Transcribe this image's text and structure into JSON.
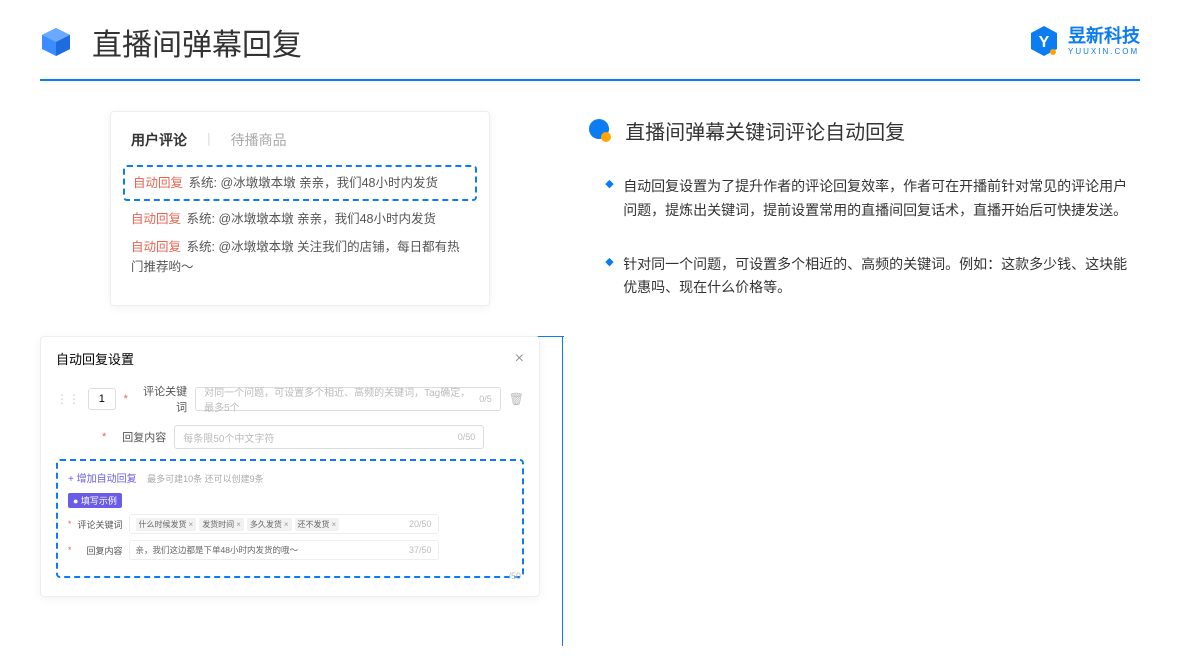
{
  "header": {
    "title": "直播间弹幕回复",
    "brand_name": "昱新科技",
    "brand_sub": "YUUXIN.COM"
  },
  "comments_panel": {
    "tab_active": "用户评论",
    "tab_inactive": "待播商品",
    "items": [
      {
        "tag": "自动回复",
        "body": "系统: @冰墩墩本墩 亲亲，我们48小时内发货"
      },
      {
        "tag": "自动回复",
        "body": "系统: @冰墩墩本墩 亲亲，我们48小时内发货"
      },
      {
        "tag": "自动回复",
        "body": "系统: @冰墩墩本墩 关注我们的店铺，每日都有热门推荐哟～"
      }
    ]
  },
  "settings_panel": {
    "title": "自动回复设置",
    "number": "1",
    "keyword_label": "评论关键词",
    "keyword_placeholder": "对同一个问题，可设置多个相近、高频的关键词，Tag确定，最多5个",
    "keyword_count": "0/5",
    "content_label": "回复内容",
    "content_placeholder": "每条限50个中文字符",
    "content_count": "0/50",
    "add_link": "+ 增加自动回复",
    "add_hint": "最多可建10条 还可以创建9条",
    "example_tag": "● 填写示例",
    "ex_keyword_label": "评论关键词",
    "ex_chips": [
      "什么时候发货",
      "发货时间",
      "多久发货",
      "还不发货"
    ],
    "ex_keyword_count": "20/50",
    "ex_content_label": "回复内容",
    "ex_content_text": "亲，我们这边都是下单48小时内发货的哦～",
    "ex_content_count": "37/50",
    "outside_count": "/50"
  },
  "right": {
    "section_title": "直播间弹幕关键词评论自动回复",
    "bullets": [
      "自动回复设置为了提升作者的评论回复效率，作者可在开播前针对常见的评论用户问题，提炼出关键词，提前设置常用的直播间回复话术，直播开始后可快捷发送。",
      "针对同一个问题，可设置多个相近的、高频的关键词。例如：这款多少钱、这块能优惠吗、现在什么价格等。"
    ]
  }
}
